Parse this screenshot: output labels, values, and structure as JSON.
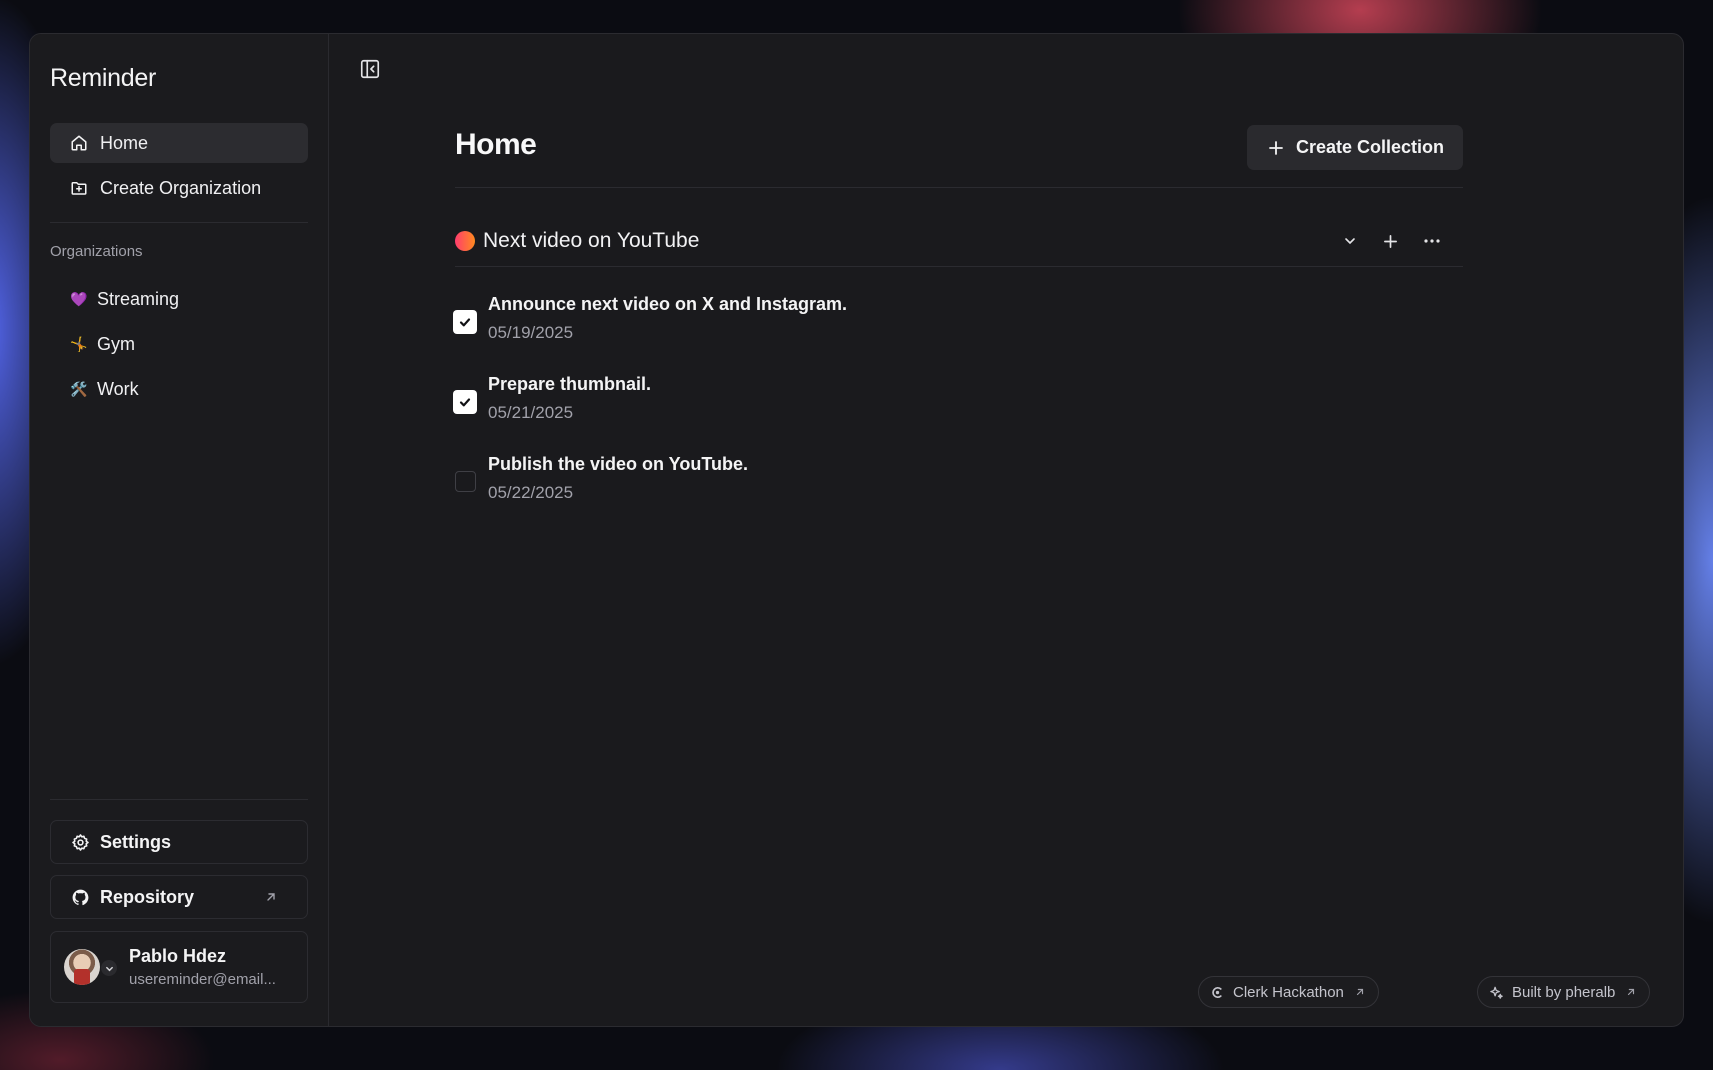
{
  "app": {
    "title": "Reminder"
  },
  "sidebar": {
    "nav": [
      {
        "label": "Home",
        "icon": "home-icon",
        "active": true
      },
      {
        "label": "Create Organization",
        "icon": "folder-plus-icon",
        "active": false
      }
    ],
    "organizations_label": "Organizations",
    "organizations": [
      {
        "emoji": "💜",
        "label": "Streaming"
      },
      {
        "emoji": "🤸",
        "label": "Gym"
      },
      {
        "emoji": "🛠️",
        "label": "Work"
      }
    ],
    "settings_label": "Settings",
    "repository_label": "Repository",
    "user": {
      "name": "Pablo Hdez",
      "email": "usereminder@email..."
    }
  },
  "main": {
    "title": "Home",
    "create_collection_label": "Create Collection",
    "collection": {
      "title": "Next video on YouTube",
      "color_start": "#ff3d6e",
      "color_end": "#ff8a1f",
      "tasks": [
        {
          "title": "Announce next video on X and Instagram.",
          "date": "05/19/2025",
          "done": true
        },
        {
          "title": "Prepare thumbnail.",
          "date": "05/21/2025",
          "done": true
        },
        {
          "title": "Publish the video on YouTube.",
          "date": "05/22/2025",
          "done": false
        }
      ]
    }
  },
  "footer": {
    "clerk_label": "Clerk Hackathon",
    "built_label": "Built by pheralb"
  }
}
